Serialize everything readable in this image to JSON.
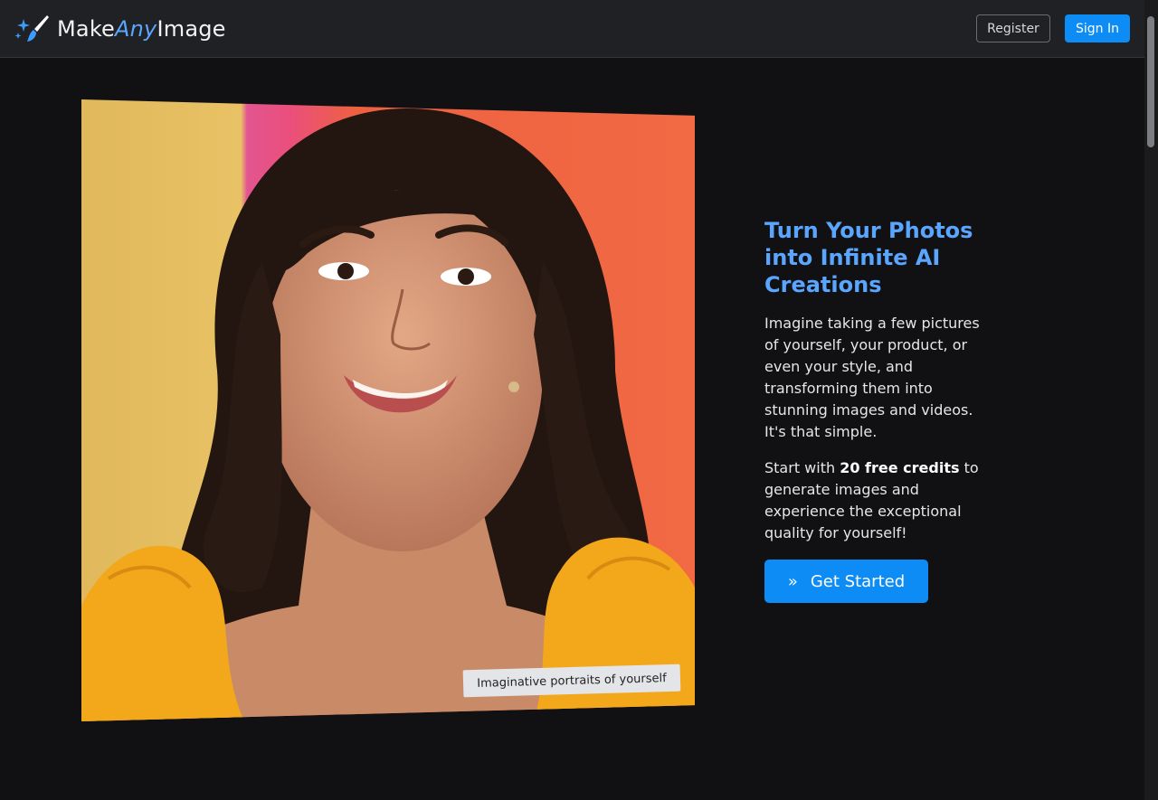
{
  "brand": {
    "part1": "Make",
    "part2": "Any",
    "part3": "Image"
  },
  "nav": {
    "register": "Register",
    "signin": "Sign In"
  },
  "hero": {
    "caption": "Imaginative portraits of yourself",
    "headline": "Turn Your Photos into Infinite AI Creations",
    "para1": "Imagine taking a few pictures of yourself, your product, or even your style, and transforming them into stunning images and videos. It's that simple.",
    "para2_pre": "Start with ",
    "para2_bold": "20 free credits",
    "para2_post": " to generate images and experience the exceptional quality for yourself!",
    "cta_icon": "»",
    "cta_label": "Get Started"
  },
  "icons": {
    "logo": "sparkle-brush-icon",
    "cta": "double-chevron-right-icon"
  },
  "colors": {
    "accent": "#0d8cf5",
    "headline": "#5aa6ff",
    "background": "#111114",
    "navbar": "#202125"
  }
}
